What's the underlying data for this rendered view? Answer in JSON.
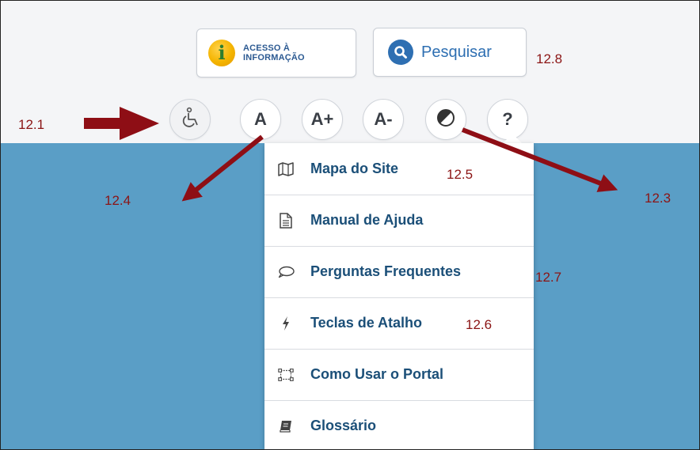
{
  "header": {
    "acesso_line1": "ACESSO À",
    "acesso_line2": "INFORMAÇÃO",
    "pesquisar": "Pesquisar"
  },
  "toolbar": {
    "font_normal": "A",
    "font_increase": "A+",
    "font_decrease": "A-",
    "help": "?"
  },
  "menu": {
    "items": [
      {
        "label": "Mapa do Site",
        "icon": "map-icon"
      },
      {
        "label": "Manual de Ajuda",
        "icon": "document-icon"
      },
      {
        "label": "Perguntas Frequentes",
        "icon": "speech-bubble-icon"
      },
      {
        "label": "Teclas de Atalho",
        "icon": "lightning-icon"
      },
      {
        "label": "Como Usar o Portal",
        "icon": "diagram-icon"
      },
      {
        "label": "Glossário",
        "icon": "book-icon"
      }
    ]
  },
  "annotations": {
    "a12_1": "12.1",
    "a12_3": "12.3",
    "a12_4": "12.4",
    "a12_5": "12.5",
    "a12_6": "12.6",
    "a12_7": "12.7",
    "a12_8": "12.8"
  },
  "colors": {
    "accent_blue": "#2e6fb2",
    "menu_text": "#1b4f78",
    "annotation": "#8b1414",
    "arrow": "#8e0e15",
    "background_blue": "#5a9ec6"
  }
}
